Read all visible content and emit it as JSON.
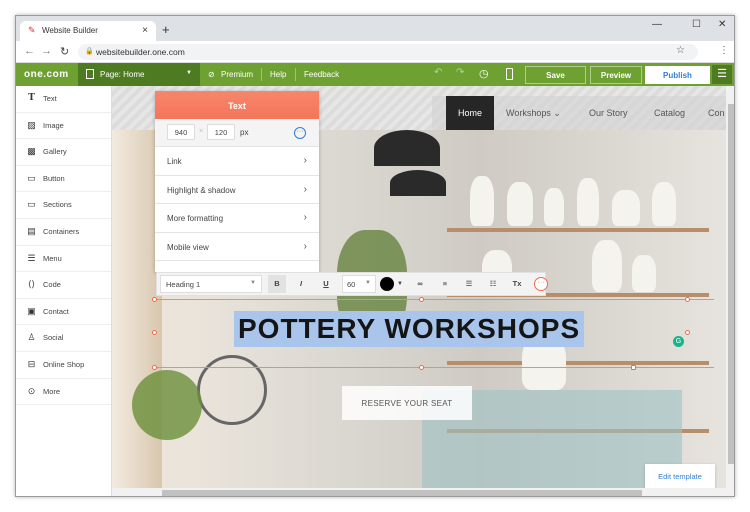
{
  "browser": {
    "tab_title": "Website Builder",
    "url": "websitebuilder.one.com",
    "new_tab": "+",
    "close": "×"
  },
  "toolbar": {
    "logo": "one.com",
    "page_selector": "Page: Home",
    "premium": "Premium",
    "help": "Help",
    "feedback": "Feedback",
    "save": "Save",
    "preview": "Preview",
    "publish": "Publish",
    "accent": "#6ea131"
  },
  "sidebar": {
    "items": [
      {
        "label": "Text",
        "icon": "text-icon"
      },
      {
        "label": "Image",
        "icon": "image-icon"
      },
      {
        "label": "Gallery",
        "icon": "gallery-icon"
      },
      {
        "label": "Button",
        "icon": "button-icon"
      },
      {
        "label": "Sections",
        "icon": "sections-icon"
      },
      {
        "label": "Containers",
        "icon": "containers-icon"
      },
      {
        "label": "Menu",
        "icon": "menu-icon"
      },
      {
        "label": "Code",
        "icon": "code-icon"
      },
      {
        "label": "Contact",
        "icon": "contact-icon"
      },
      {
        "label": "Social",
        "icon": "social-icon"
      },
      {
        "label": "Online Shop",
        "icon": "shop-icon"
      },
      {
        "label": "More",
        "icon": "more-icon"
      }
    ]
  },
  "site": {
    "nav": [
      "Home",
      "Workshops",
      "Our Story",
      "Catalog",
      "Con"
    ],
    "headline": "POTTERY WORKSHOPS",
    "cta": "RESERVE YOUR SEAT"
  },
  "panel": {
    "title": "Text",
    "width": "940",
    "height": "120",
    "unit": "px",
    "rows": [
      "Link",
      "Highlight & shadow",
      "More formatting",
      "Mobile view"
    ]
  },
  "format": {
    "style": "Heading 1",
    "size": "60",
    "bold": "B",
    "italic": "I",
    "underline": "U",
    "clear": "Tx",
    "color": "#000000"
  },
  "edit_template": "Edit template"
}
